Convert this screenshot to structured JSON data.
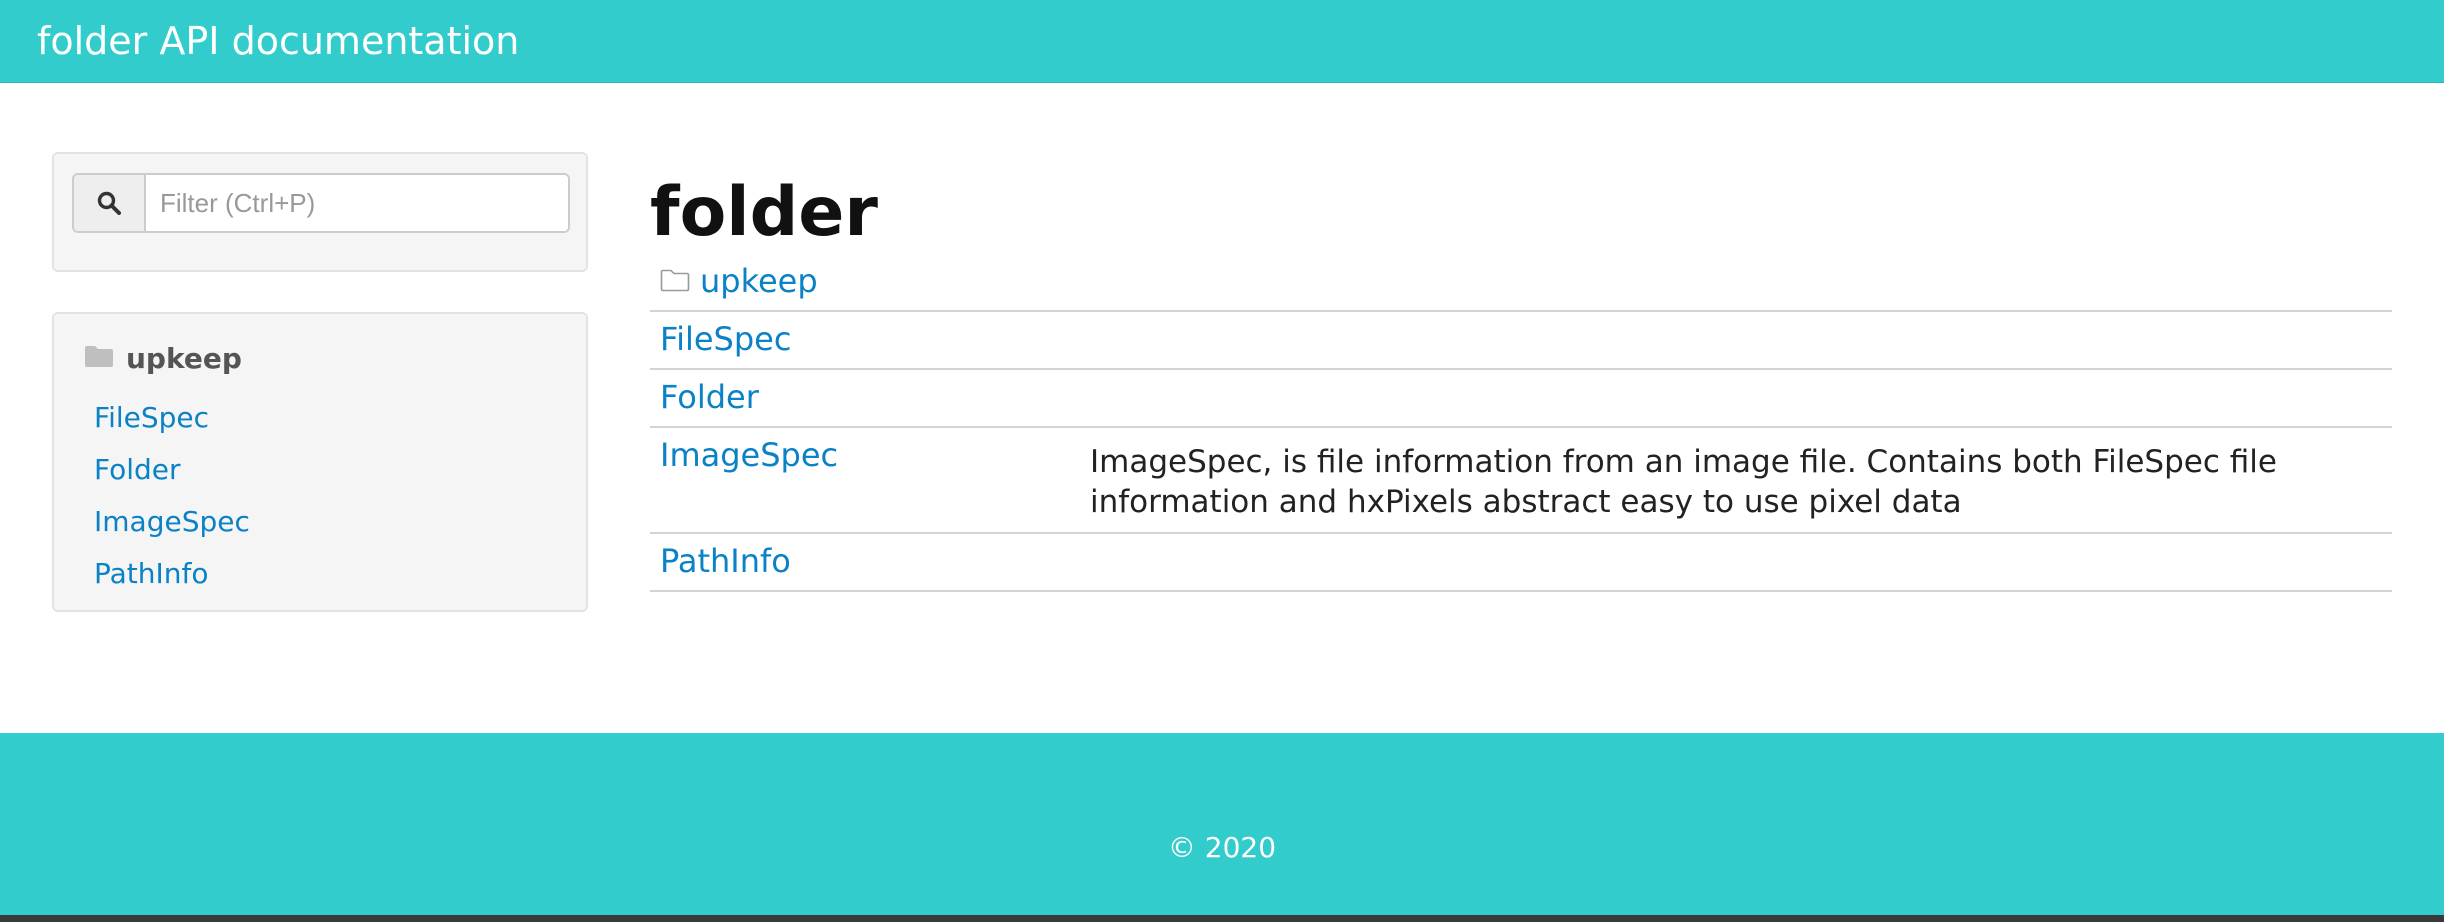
{
  "header": {
    "title": "folder API documentation"
  },
  "search": {
    "placeholder": "Filter (Ctrl+P)",
    "icon": "search-icon"
  },
  "sidebar": {
    "package": {
      "label": "upkeep",
      "icon": "folder-icon"
    },
    "items": [
      {
        "label": "FileSpec"
      },
      {
        "label": "Folder"
      },
      {
        "label": "ImageSpec"
      },
      {
        "label": "PathInfo"
      }
    ]
  },
  "main": {
    "title": "folder",
    "rows": [
      {
        "name": "upkeep",
        "type": "package",
        "icon": "folder-open-icon",
        "description": ""
      },
      {
        "name": "FileSpec",
        "type": "class",
        "description": ""
      },
      {
        "name": "Folder",
        "type": "class",
        "description": ""
      },
      {
        "name": "ImageSpec",
        "type": "class",
        "description": "ImageSpec, is file information from an image file. Contains both FileSpec file information and hxPixels abstract easy to use pixel data"
      },
      {
        "name": "PathInfo",
        "type": "class",
        "description": ""
      }
    ]
  },
  "footer": {
    "copyright": "© 2020"
  },
  "colors": {
    "accent": "#33cccc",
    "link": "#0b81c6"
  }
}
